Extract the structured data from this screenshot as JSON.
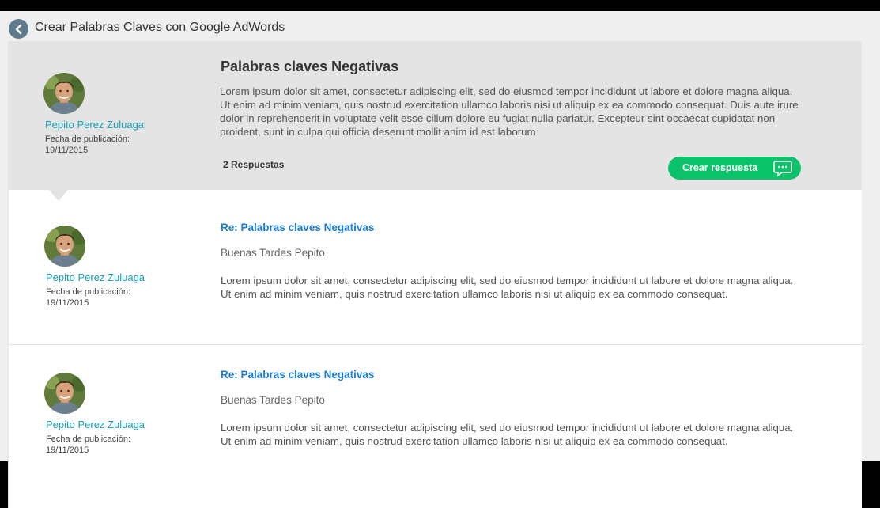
{
  "header": {
    "title": "Crear Palabras Claves con Google AdWords"
  },
  "question": {
    "author": "Pepito Perez Zuluaga",
    "pub_label": "Fecha de publicación:",
    "pub_date": "19/11/2015",
    "title": "Palabras claves Negativas",
    "body": "Lorem ipsum dolor sit amet, consectetur adipiscing elit, sed do eiusmod tempor incididunt ut labore et dolore magna aliqua. Ut enim ad minim veniam, quis nostrud exercitation ullamco laboris nisi ut aliquip ex ea commodo consequat. Duis aute irure dolor in reprehenderit in voluptate velit esse cillum dolore eu fugiat nulla pariatur. Excepteur sint occaecat cupidatat non proident, sunt in culpa qui officia deserunt mollit anim id est laborum",
    "responses_count": "2 Respuestas",
    "reply_button": "Crear respuesta"
  },
  "answers": [
    {
      "author": "Pepito Perez Zuluaga",
      "pub_label": "Fecha de publicación:",
      "pub_date": "19/11/2015",
      "title": "Re: Palabras claves Negativas",
      "greeting": "Buenas Tardes Pepito",
      "body": "Lorem ipsum dolor sit amet, consectetur adipiscing elit, sed do eiusmod tempor incididunt ut labore et dolore magna aliqua. Ut enim ad minim veniam, quis nostrud exercitation ullamco laboris nisi ut aliquip ex ea commodo consequat."
    },
    {
      "author": "Pepito Perez Zuluaga",
      "pub_label": "Fecha de publicación:",
      "pub_date": "19/11/2015",
      "title": "Re: Palabras claves Negativas",
      "greeting": "Buenas Tardes Pepito",
      "body": "Lorem ipsum dolor sit amet, consectetur adipiscing elit, sed do eiusmod tempor incididunt ut labore et dolore magna aliqua. Ut enim ad minim veniam, quis nostrud exercitation ullamco laboris nisi ut aliquip ex ea commodo consequat."
    }
  ],
  "icons": {
    "back": "chevron-left-icon",
    "reply": "chat-bubble-icon",
    "avatar": "avatar"
  },
  "colors": {
    "accent_teal": "#17a2b8",
    "link_blue": "#1a7ed6",
    "button_green": "#0ac26a",
    "back_button": "#5e7a8b"
  }
}
